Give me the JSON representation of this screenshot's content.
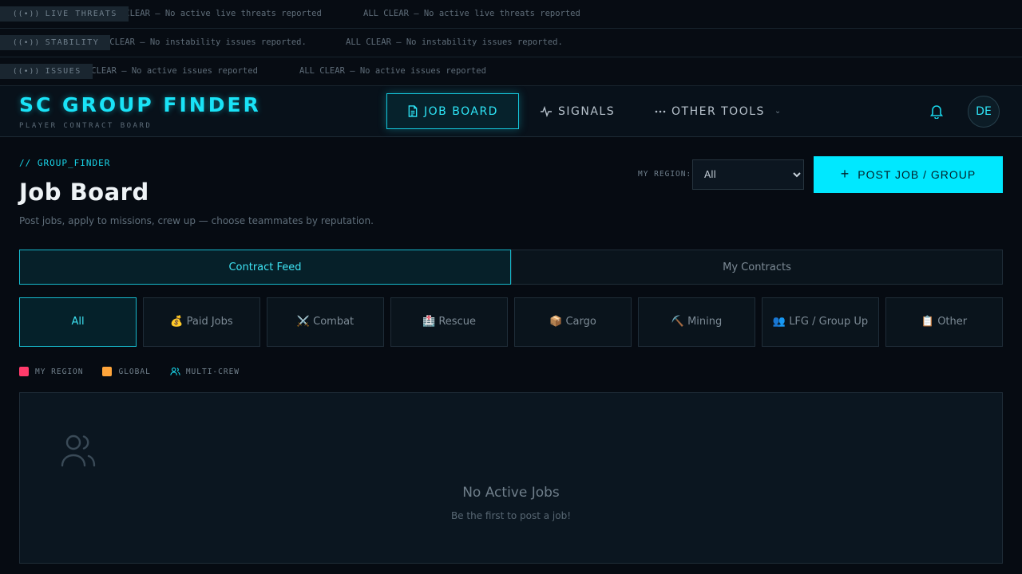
{
  "tickers": [
    {
      "tag": "LIVE THREATS",
      "message": "ALL CLEAR — No active live threats reported"
    },
    {
      "tag": "STABILITY",
      "message": "ALL CLEAR — No instability issues reported."
    },
    {
      "tag": "ISSUES",
      "message": "ALL CLEAR — No active issues reported"
    }
  ],
  "header": {
    "logo": "SC GROUP FINDER",
    "logo_sub": "PLAYER CONTRACT BOARD",
    "nav": {
      "job_board": "JOB BOARD",
      "signals": "SIGNALS",
      "other_tools": "OTHER TOOLS"
    },
    "avatar_initials": "DE"
  },
  "page": {
    "breadcrumb": "// GROUP_FINDER",
    "title": "Job Board",
    "subtitle": "Post jobs, apply to missions, crew up — choose teammates by reputation.",
    "region_label": "MY REGION:",
    "region_value": "All",
    "post_button": "POST JOB / GROUP"
  },
  "tabs": [
    {
      "label": "Contract Feed",
      "active": true
    },
    {
      "label": "My Contracts",
      "active": false
    }
  ],
  "categories": [
    {
      "label": "All",
      "active": true
    },
    {
      "label": "💰 Paid Jobs"
    },
    {
      "label": "⚔️ Combat"
    },
    {
      "label": "🏥 Rescue"
    },
    {
      "label": "📦 Cargo"
    },
    {
      "label": "⛏️ Mining"
    },
    {
      "label": "👥 LFG / Group Up"
    },
    {
      "label": "📋 Other"
    }
  ],
  "legend": {
    "my_region": "MY REGION",
    "global": "GLOBAL",
    "multi_crew": "MULTI-CREW",
    "colors": {
      "my_region": "#ff3b6b",
      "global": "#ffa53b",
      "multi_crew": "#19d6ea"
    }
  },
  "empty_state": {
    "title": "No Active Jobs",
    "subtitle": "Be the first to post a job!"
  }
}
